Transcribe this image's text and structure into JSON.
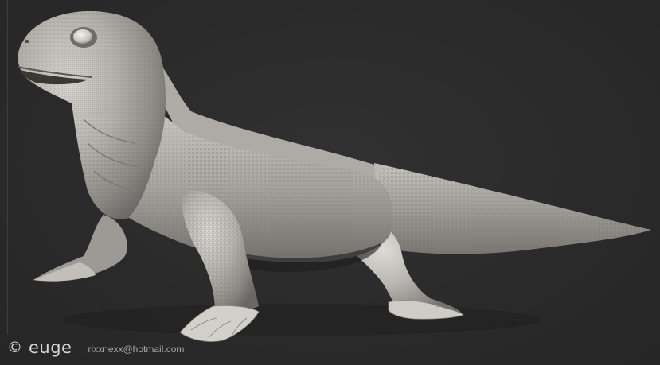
{
  "image": {
    "subject": "lizard-sculpt",
    "background_color": "#2b2b2b",
    "model_color": "#c9c6c2"
  },
  "signature": {
    "symbol": "©",
    "name": "euge",
    "email": "rixxnexx@hotmail.com"
  }
}
